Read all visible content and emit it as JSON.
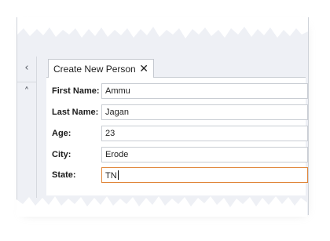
{
  "window": {
    "tab_title": "Create New Person",
    "close_glyph": "✕",
    "rail_collapse_glyph": "‹",
    "rail_up_glyph": "˄"
  },
  "form": {
    "fields": [
      {
        "label": "First Name:",
        "value": "Ammu"
      },
      {
        "label": "Last Name:",
        "value": "Jagan"
      },
      {
        "label": "Age:",
        "value": "23"
      },
      {
        "label": "City:",
        "value": "Erode"
      },
      {
        "label": "State:",
        "value": "TN"
      }
    ],
    "active_field_index": 4
  },
  "colors": {
    "active_border": "#e0863a",
    "chrome_bg": "#eef0f5"
  }
}
